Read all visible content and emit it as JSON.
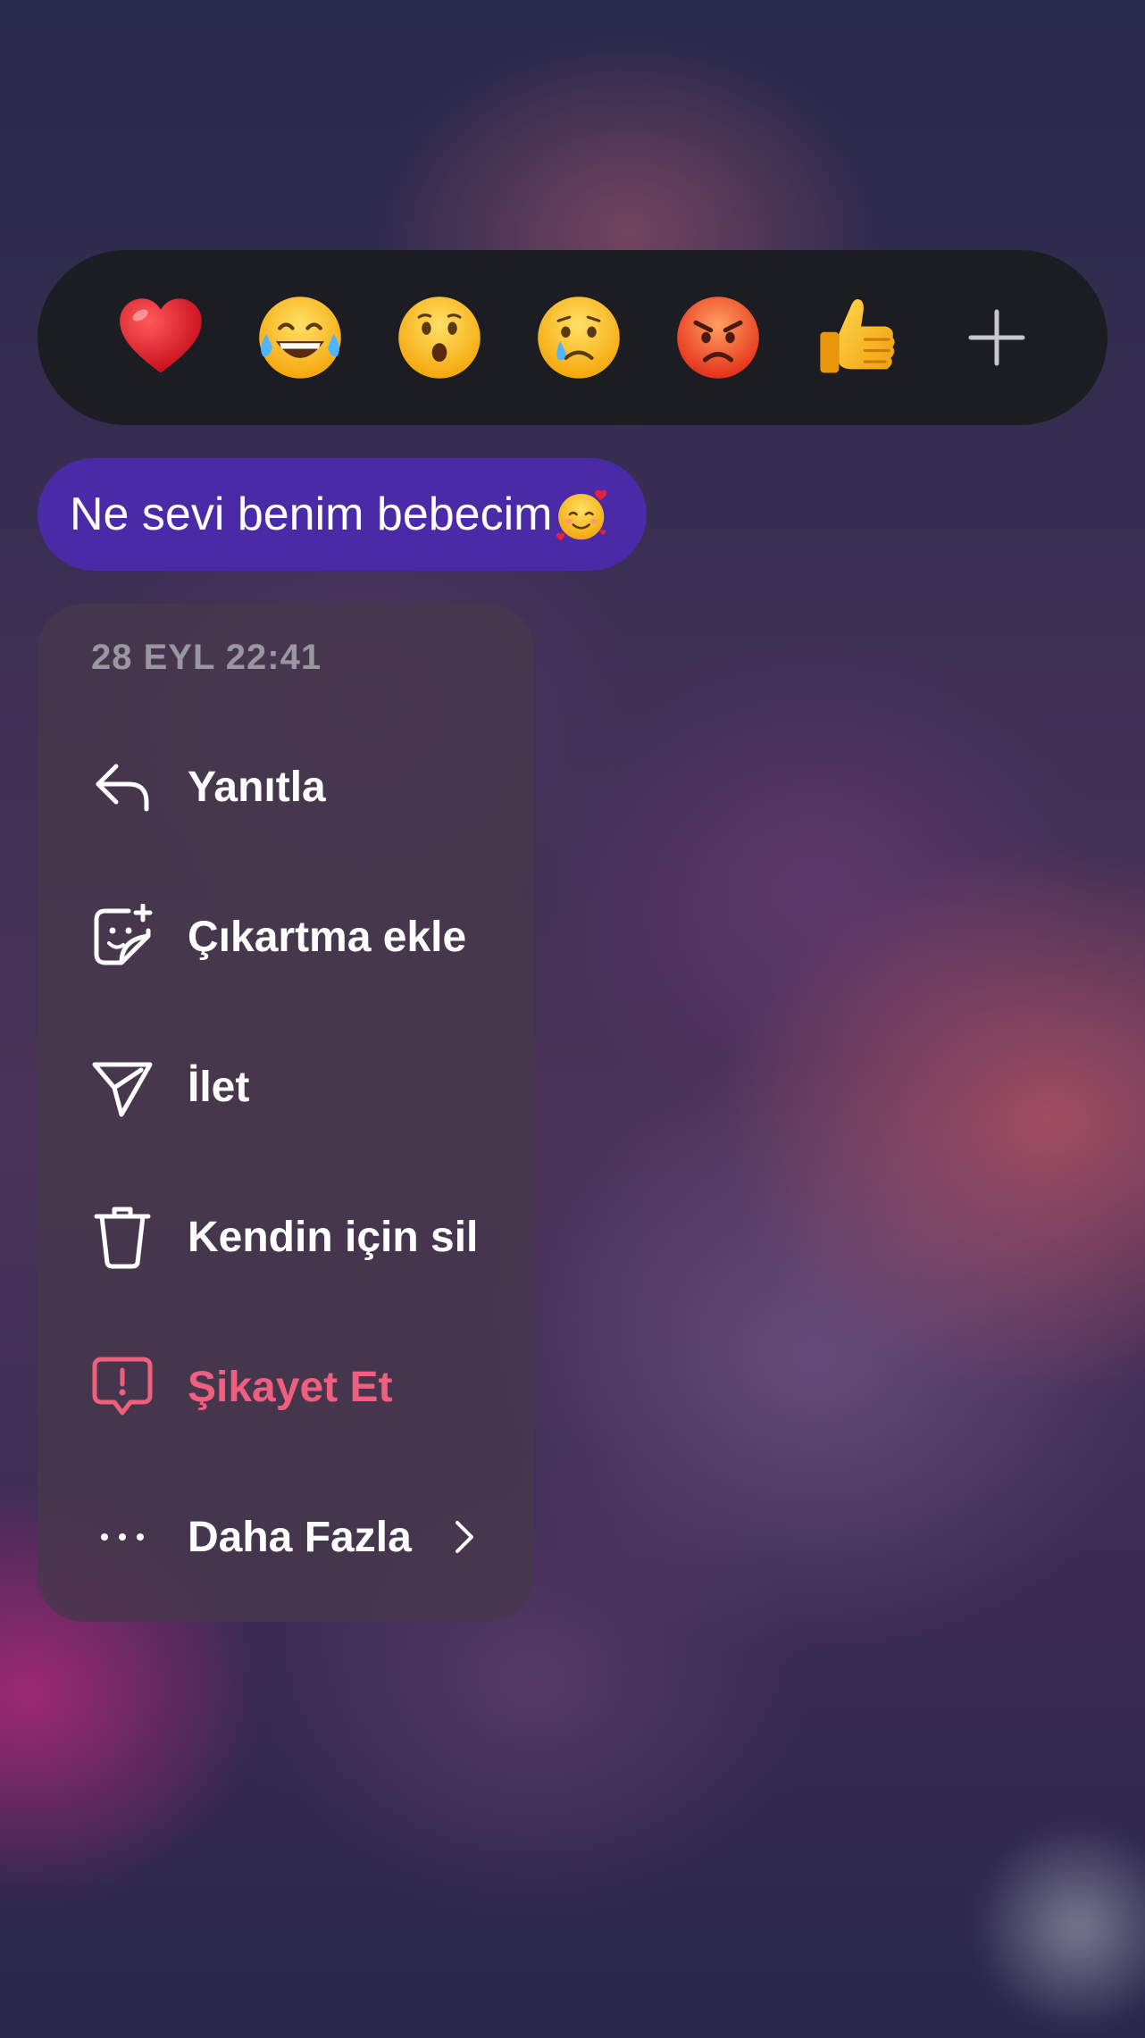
{
  "reactions": [
    {
      "name": "heart",
      "label": "❤️"
    },
    {
      "name": "laughing",
      "label": "😂"
    },
    {
      "name": "surprised",
      "label": "😮"
    },
    {
      "name": "crying",
      "label": "😢"
    },
    {
      "name": "angry",
      "label": "😡"
    },
    {
      "name": "thumbs-up",
      "label": "👍"
    },
    {
      "name": "add-reaction",
      "label": "+"
    }
  ],
  "message": {
    "text": "Ne sevi benim bebecim",
    "emoji": "🥰"
  },
  "menu": {
    "timestamp": "28 EYL 22:41",
    "items": [
      {
        "label": "Yanıtla",
        "icon": "reply-icon"
      },
      {
        "label": "Çıkartma ekle",
        "icon": "add-sticker-icon"
      },
      {
        "label": "İlet",
        "icon": "forward-icon"
      },
      {
        "label": "Kendin için sil",
        "icon": "trash-icon"
      },
      {
        "label": "Şikayet Et",
        "icon": "report-icon",
        "color": "#f0607e"
      },
      {
        "label": "Daha Fazla",
        "icon": "more-icon",
        "trailing_icon": "chevron-right-icon"
      }
    ]
  },
  "colors": {
    "reaction_bar": "#1c1d22",
    "bubble": "#4a2aa6",
    "menu_text": "#ffffff",
    "danger": "#f0607e",
    "timestamp": "#9a97a2"
  }
}
